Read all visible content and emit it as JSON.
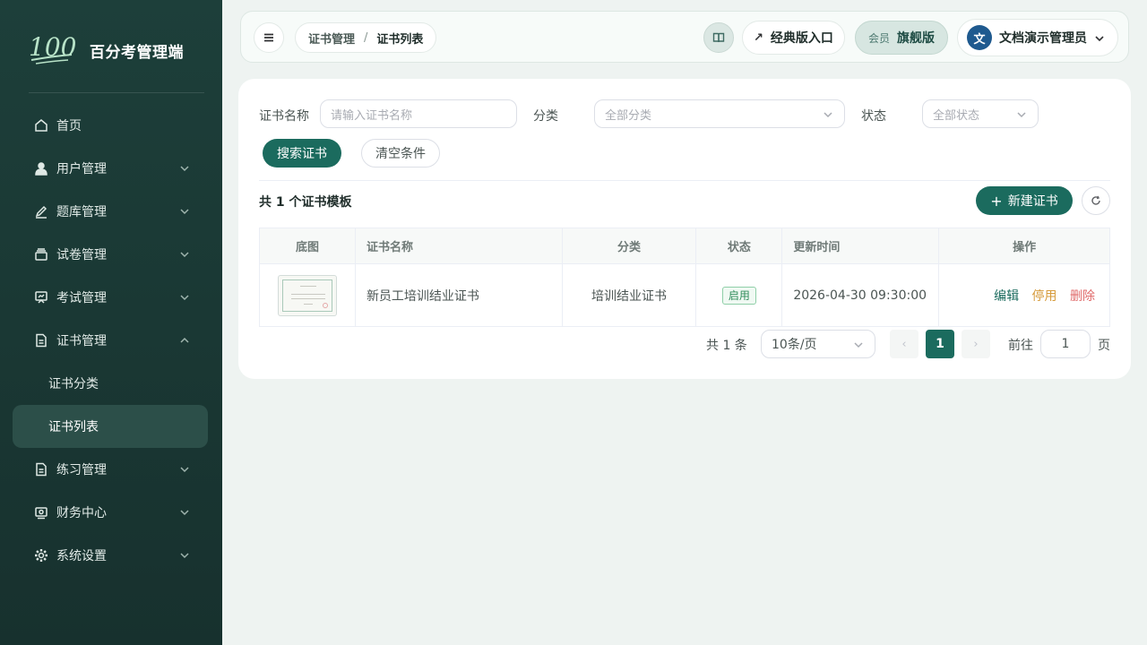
{
  "brand": {
    "logo_text": "100",
    "name": "百分考管理端"
  },
  "sidebar": {
    "items": [
      {
        "label": "首页",
        "icon": "home-icon"
      },
      {
        "label": "用户管理",
        "icon": "user-icon"
      },
      {
        "label": "题库管理",
        "icon": "edit-icon"
      },
      {
        "label": "试卷管理",
        "icon": "paper-stack-icon"
      },
      {
        "label": "考试管理",
        "icon": "monitor-icon"
      },
      {
        "label": "证书管理",
        "icon": "document-icon"
      },
      {
        "label": "练习管理",
        "icon": "document-icon"
      },
      {
        "label": "财务中心",
        "icon": "wallet-icon"
      },
      {
        "label": "系统设置",
        "icon": "gear-icon"
      }
    ],
    "sub_items": [
      {
        "label": "证书分类"
      },
      {
        "label": "证书列表",
        "active": true
      }
    ]
  },
  "header": {
    "breadcrumb": [
      "证书管理",
      "/",
      "证书列表"
    ],
    "classic_label": "经典版入口",
    "member_label": "会员",
    "member_tier": "旗舰版",
    "avatar_text": "文",
    "user_name": "文档演示管理员"
  },
  "filters": {
    "name_label": "证书名称",
    "name_placeholder": "请输入证书名称",
    "category_label": "分类",
    "category_value": "全部分类",
    "status_label": "状态",
    "status_value": "全部状态",
    "search_btn": "搜索证书",
    "clear_btn": "清空条件"
  },
  "list": {
    "summary": "共 1 个证书模板",
    "new_btn": "新建证书",
    "columns": [
      "底图",
      "证书名称",
      "分类",
      "状态",
      "更新时间",
      "操作"
    ],
    "rows": [
      {
        "name": "新员工培训结业证书",
        "category": "培训结业证书",
        "status": "启用",
        "updated": "2026-04-30 09:30:00",
        "ops": [
          "编辑",
          "停用",
          "删除"
        ]
      }
    ]
  },
  "pagination": {
    "total": "共 1 条",
    "page_size": "10条/页",
    "current": "1",
    "goto_label": "前往",
    "goto_value": "1",
    "unit": "页"
  },
  "colors": {
    "primary": "#1b6b5e",
    "sidebar": "#1d3f3a",
    "danger": "#e06b6b",
    "warning": "#d69a3a"
  }
}
